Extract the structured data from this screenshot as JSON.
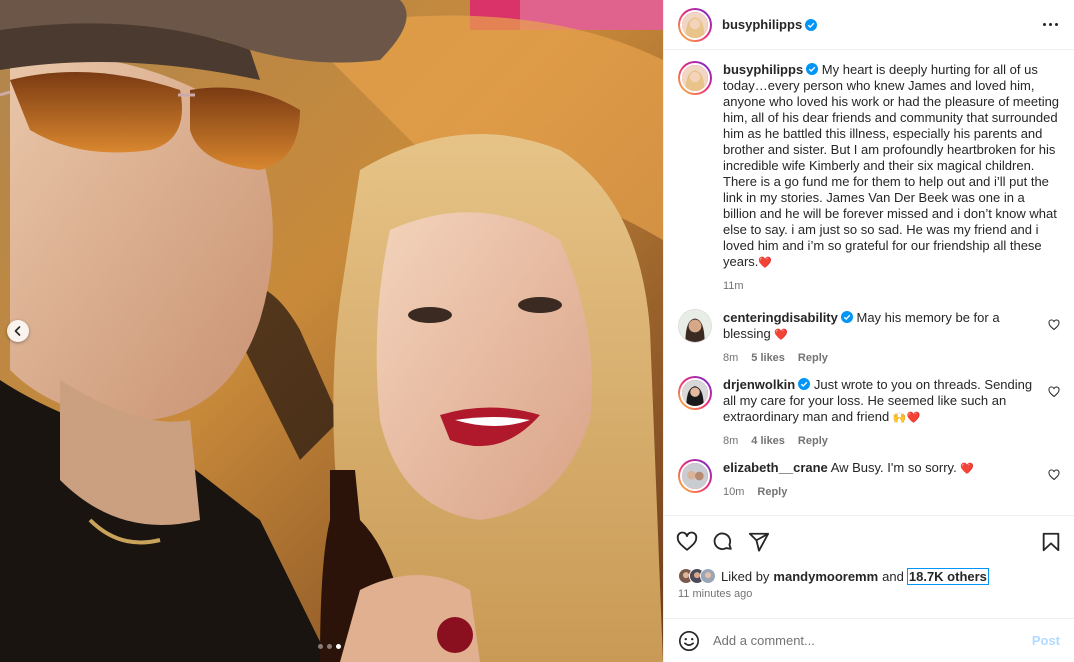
{
  "post": {
    "author": "busyphilipps",
    "caption": "My heart is deeply hurting for all of us today…every person who knew James and loved him, anyone who loved his work or had the pleasure of meeting him, all of his dear friends and community that surrounded him as he battled this illness, especially his parents and brother and sister. But I am profoundly heartbroken for his incredible wife Kimberly and their six magical children. There is a go fund me for them to help out and i’ll put the link in my stories. James Van Der Beek was one in a billion and he will be forever missed and i don’t know what else to say. i am just so so sad. He was my friend and i loved him and i’m so grateful for our friendship all these years.",
    "caption_emoji": "❤️",
    "caption_time": "11m",
    "carousel": {
      "total": 3,
      "active": 2
    }
  },
  "comments": [
    {
      "username": "centeringdisability",
      "verified": true,
      "text": "May his memory be for a blessing",
      "emoji": "❤️",
      "time": "8m",
      "likes": "5 likes",
      "reply": "Reply"
    },
    {
      "username": "drjenwolkin",
      "verified": true,
      "text": "Just wrote to you on threads. Sending all my care for your loss. He seemed like such an extraordinary man and friend",
      "emoji": "🙌❤️",
      "time": "8m",
      "likes": "4 likes",
      "reply": "Reply"
    },
    {
      "username": "elizabeth__crane",
      "verified": false,
      "text": "Aw Busy. I'm so sorry.",
      "emoji": "❤️",
      "time": "10m",
      "likes": "",
      "reply": "Reply"
    }
  ],
  "likes": {
    "prefix": "Liked by",
    "user": "mandymooremm",
    "and": "and",
    "others": "18.7K others"
  },
  "time_ago": "11 minutes ago",
  "composer": {
    "placeholder": "Add a comment...",
    "post_label": "Post"
  },
  "icons": {
    "like": "heart-icon",
    "comment": "comment-icon",
    "share": "share-icon",
    "save": "bookmark-icon",
    "more": "more-icon",
    "emoji": "emoji-icon",
    "verified": "verified-icon",
    "prev": "chevron-left-icon"
  },
  "colors": {
    "verified": "#0095f6",
    "heart": "#e0245e",
    "post_disabled": "#b3dbff"
  }
}
